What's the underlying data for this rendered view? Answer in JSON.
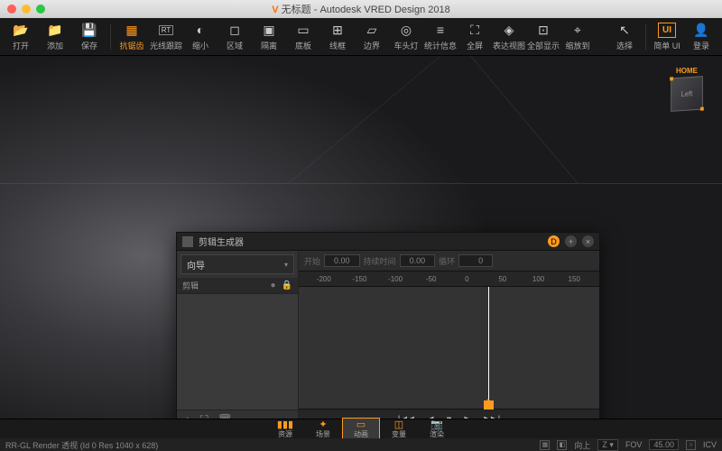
{
  "title": {
    "prefix": "无标题",
    "app": "Autodesk VRED Design 2018"
  },
  "toolbar": [
    {
      "name": "open",
      "label": "打开"
    },
    {
      "name": "add",
      "label": "添加"
    },
    {
      "name": "save",
      "label": "保存"
    },
    {
      "name": "aa",
      "label": "抗锯齿",
      "on": true
    },
    {
      "name": "rt",
      "label": "光线跟踪"
    },
    {
      "name": "shrink",
      "label": "缩小"
    },
    {
      "name": "region",
      "label": "区域"
    },
    {
      "name": "iso",
      "label": "隔离"
    },
    {
      "name": "floor",
      "label": "底板"
    },
    {
      "name": "wire",
      "label": "线框"
    },
    {
      "name": "edge",
      "label": "边界"
    },
    {
      "name": "head",
      "label": "车头灯"
    },
    {
      "name": "stats",
      "label": "统计信息"
    },
    {
      "name": "full",
      "label": "全屏"
    },
    {
      "name": "expr",
      "label": "表达视图"
    },
    {
      "name": "showall",
      "label": "全部显示"
    },
    {
      "name": "zoomto",
      "label": "缩放到"
    }
  ],
  "toolbar_right": {
    "select": "选择",
    "simpleui": "简单 UI",
    "login": "登录"
  },
  "viewcube": {
    "home": "HOME",
    "face": "Left"
  },
  "panel": {
    "title": "剪辑生成器",
    "wizard": "向导",
    "clip_header": "剪辑",
    "params": {
      "start_lbl": "开始",
      "start_val": "0.00",
      "dur_lbl": "持续时间",
      "dur_val": "0.00",
      "loop_lbl": "循环",
      "loop_val": "0"
    },
    "ruler": [
      "-200",
      "-150",
      "-100",
      "-50",
      "0",
      "50",
      "100",
      "150"
    ],
    "playpos": "0"
  },
  "bottom_tabs": [
    {
      "name": "assets",
      "label": "资源"
    },
    {
      "name": "scene",
      "label": "场景"
    },
    {
      "name": "anim",
      "label": "动画",
      "sel": true
    },
    {
      "name": "variant",
      "label": "变量"
    },
    {
      "name": "render",
      "label": "渲染"
    }
  ],
  "status": {
    "left": "RR-GL  Render  透视  (Id 0 Res 1040 x 628)",
    "up_lbl": "向上",
    "up_axis": "Z",
    "fov_lbl": "FOV",
    "fov_val": "45.00",
    "icv": "ICV"
  }
}
